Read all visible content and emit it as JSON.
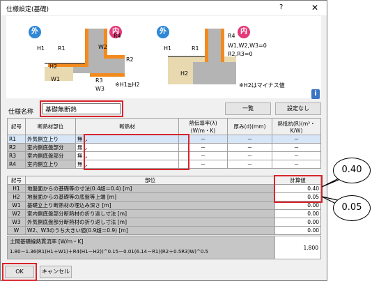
{
  "window": {
    "title": "仕様設定(基礎)",
    "help": "?",
    "close": "✕"
  },
  "diagram": {
    "left": {
      "out": "外",
      "in": "内",
      "labels": [
        "H1",
        "R1",
        "R4",
        "W2",
        "R2",
        "H2",
        "W1",
        "R3",
        "W3"
      ],
      "note": "※H1≧H2"
    },
    "right": {
      "out": "外",
      "in": "内",
      "labels": [
        "H1",
        "R1",
        "R4",
        "H2"
      ],
      "desc1": "W1,W2,W3=0",
      "desc2": "R2,R3=0",
      "note": "※H2はマイナス値"
    }
  },
  "spec": {
    "label": "仕様名称",
    "value": "基礎無断熱",
    "list_button": "一覧",
    "none_button": "設定なし"
  },
  "materials": {
    "headers": [
      "記号",
      "断熱材部位",
      "断熱材",
      "熱伝導率(λ)(W/m・K)",
      "厚み(d)(mm)",
      "熱抵抗(R)(m²・K/W)"
    ],
    "rows": [
      {
        "code": "R1",
        "part": "外気側立上り",
        "mat": "無し",
        "lam": "－",
        "d": "－",
        "r": "－"
      },
      {
        "code": "R2",
        "part": "室内側底盤部分",
        "mat": "無し",
        "lam": "－",
        "d": "－",
        "r": "－"
      },
      {
        "code": "R3",
        "part": "室内側底盤部分",
        "mat": "無し",
        "lam": "－",
        "d": "－",
        "r": "－"
      },
      {
        "code": "R4",
        "part": "室内側立上り",
        "mat": "無し",
        "lam": "－",
        "d": "－",
        "r": "－"
      }
    ]
  },
  "dims": {
    "headers": [
      "記号",
      "部位",
      "計算値"
    ],
    "rows": [
      {
        "code": "H1",
        "desc": "地盤面からの基礎等の寸法(0.4超＝0.4) [m]",
        "val": "0.40"
      },
      {
        "code": "H2",
        "desc": "地盤面からの基礎等の底盤等上端 [m]",
        "val": "0.05"
      },
      {
        "code": "W1",
        "desc": "基礎立上り断熱材の埋込み深さ [m]",
        "val": "0.00"
      },
      {
        "code": "W2",
        "desc": "室内側底盤部分断熱材の折り返し寸法 [m]",
        "val": "0.00"
      },
      {
        "code": "W3",
        "desc": "外気側底盤部分断熱材の折り返し寸法 [m]",
        "val": "0.00"
      },
      {
        "code": "W",
        "desc": "W2、W3のうち大きい値(0.9超＝0.9) [m]",
        "val": "0.00"
      }
    ]
  },
  "formula": {
    "title": "土間基礎線熱貫流率 [W/m・K]",
    "text": "1.80－1.36(R1(H1＋W1)＋R4(H1－H2))^0.15－0.01(6.14－R1)(R2＋0.5R3)W)^0.5",
    "value": "1.800"
  },
  "buttons": {
    "ok": "OK",
    "cancel": "キャンセル"
  },
  "callouts": [
    "0.40",
    "0.05"
  ],
  "colors": {
    "orange": "#f28a1e",
    "gray": "#b4b4b4",
    "out": "#2f87d6",
    "in": "#e23a7a"
  }
}
